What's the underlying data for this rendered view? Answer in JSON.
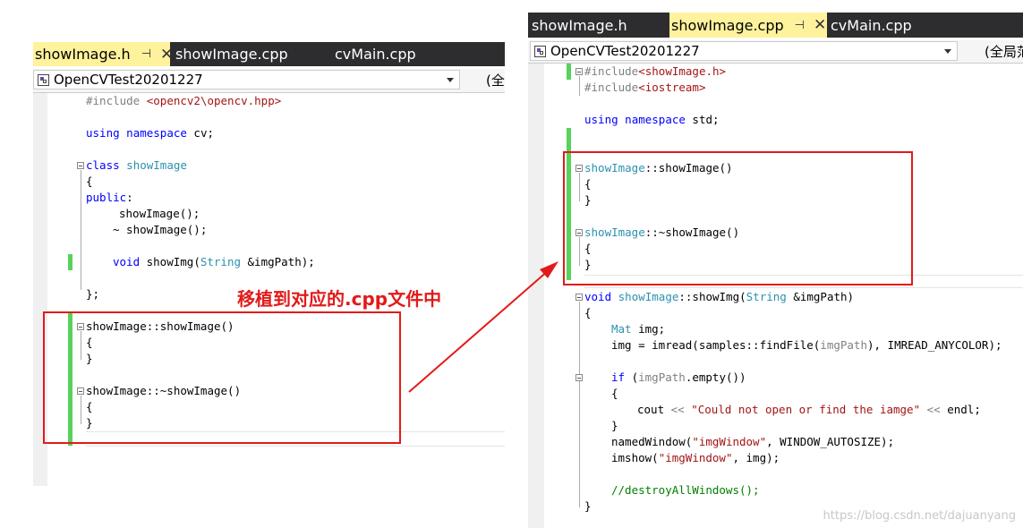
{
  "left_panel": {
    "tabs": [
      {
        "label": "showImage.h",
        "active": true,
        "pin": "⊣",
        "close": "✕"
      },
      {
        "label": "showImage.cpp",
        "active": false
      },
      {
        "label": "cvMain.cpp",
        "active": false
      }
    ],
    "project_selector": {
      "value": "OpenCVTest20201227"
    },
    "scope_selector": {
      "value": "(全"
    },
    "code": {
      "include": "#include",
      "include_path": " <opencv2\\opencv.hpp>",
      "using_kw": "using",
      "namespace_kw": "namespace",
      "namespace_name": " cv;",
      "class_kw": "class",
      "class_name": "showImage",
      "open_brace": "{",
      "public_kw": "public",
      "colon": ":",
      "ctor_decl": "showImage();",
      "dtor_decl": "~ showImage();",
      "void_kw": "void",
      "method_name": " showImg(",
      "string_type": "String",
      "method_params": " &imgPath);",
      "class_end": "};",
      "ctor_def": "showImage::showImage()",
      "dtor_def": "showImage::~showImage()",
      "close_brace": "}"
    }
  },
  "annotation": {
    "text": "移植到对应的.cpp文件中",
    "color": "#e21a1a"
  },
  "right_panel": {
    "tabs": [
      {
        "label": "showImage.h",
        "active": false
      },
      {
        "label": "showImage.cpp",
        "active": true,
        "pin": "⊣",
        "close": "✕"
      },
      {
        "label": "cvMain.cpp",
        "active": false
      }
    ],
    "project_selector": {
      "value": "OpenCVTest20201227"
    },
    "scope_selector": {
      "value": "(全局范"
    },
    "code": {
      "include": "#include",
      "include1_path": "<showImage.h>",
      "include2_path": "<iostream>",
      "using_kw": "using",
      "namespace_kw": "namespace",
      "namespace_name": " std;",
      "class_name": "showImage",
      "ctor_suffix": "::showImage()",
      "dtor_suffix": "::~showImage()",
      "open_brace": "{",
      "close_brace": "}",
      "void_kw": "void",
      "method_scope": "::showImg(",
      "string_type": "String",
      "param_sig": " &imgPath)",
      "mat_type": "Mat",
      "mat_decl": " img;",
      "imread_line": "img = imread(samples::findFile(",
      "imgpath_arg": "imgPath",
      "imread_end": "), IMREAD_ANYCOLOR);",
      "if_kw": "if",
      "if_open": " (",
      "if_rest": ".empty())",
      "cout_start": "cout ",
      "shift_op": "<<",
      "message": " \"Could not open or find the iamge\" ",
      "endl_part": " endl;",
      "named_window_start": "namedWindow(",
      "window_name": "\"imgWindow\"",
      "named_window_end": ", WINDOW_AUTOSIZE);",
      "imshow_start": "imshow(",
      "imshow_end": ", img);",
      "comment": "//destroyAllWindows();"
    }
  },
  "watermark": "https://blog.csdn.net/dajuanyang"
}
